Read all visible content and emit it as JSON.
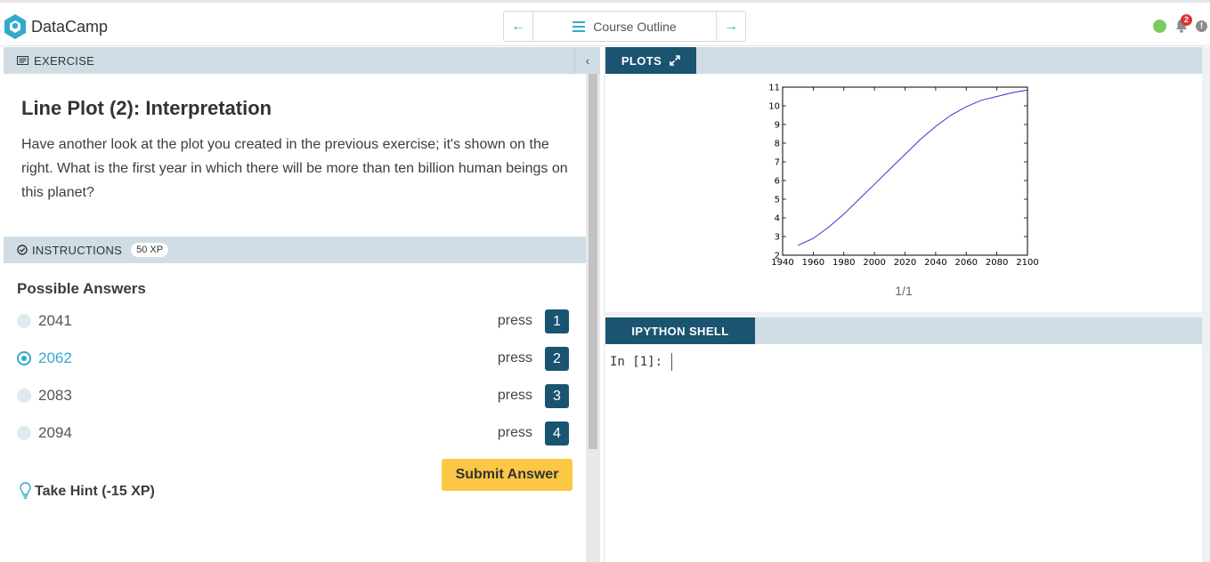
{
  "app": {
    "name": "DataCamp"
  },
  "nav": {
    "outline_label": "Course Outline"
  },
  "notifications": {
    "count": "2"
  },
  "exercise": {
    "header": "EXERCISE",
    "title": "Line Plot (2): Interpretation",
    "body": "Have another look at the plot you created in the previous exercise; it's shown on the right. What is the first year in which there will be more than ten billion human beings on this planet?"
  },
  "instructions": {
    "header": "INSTRUCTIONS",
    "xp": "50 XP",
    "possible_answers_label": "Possible Answers",
    "press_label": "press",
    "answers": [
      {
        "label": "2041",
        "key": "1",
        "selected": false
      },
      {
        "label": "2062",
        "key": "2",
        "selected": true
      },
      {
        "label": "2083",
        "key": "3",
        "selected": false
      },
      {
        "label": "2094",
        "key": "4",
        "selected": false
      }
    ],
    "submit_label": "Submit Answer",
    "hint_label": "Take Hint (-15 XP)"
  },
  "plots": {
    "tab_label": "PLOTS",
    "pager": "1/1"
  },
  "shell": {
    "tab_label": "IPYTHON SHELL",
    "prompt": "In [1]:"
  },
  "colors": {
    "brand_dark": "#1a5471",
    "accent": "#33aacc",
    "submit": "#fcc744",
    "header_bg": "#d0dde5",
    "status_green": "#7ccc5d",
    "badge_red": "#dd3333",
    "line": "#3333cc"
  },
  "chart_data": {
    "type": "line",
    "title": "",
    "xlabel": "",
    "ylabel": "",
    "xlim": [
      1940,
      2100
    ],
    "ylim": [
      2,
      11
    ],
    "xticks": [
      1940,
      1960,
      1980,
      2000,
      2020,
      2040,
      2060,
      2080,
      2100
    ],
    "yticks": [
      2,
      3,
      4,
      5,
      6,
      7,
      8,
      9,
      10,
      11
    ],
    "grid": false,
    "series": [
      {
        "x": [
          1950,
          1960,
          1970,
          1980,
          1990,
          2000,
          2010,
          2020,
          2030,
          2040,
          2050,
          2060,
          2070,
          2080,
          2090,
          2100
        ],
        "y": [
          2.53,
          2.9,
          3.5,
          4.2,
          5.0,
          5.8,
          6.6,
          7.4,
          8.2,
          8.9,
          9.5,
          9.95,
          10.3,
          10.5,
          10.7,
          10.85
        ]
      }
    ]
  }
}
